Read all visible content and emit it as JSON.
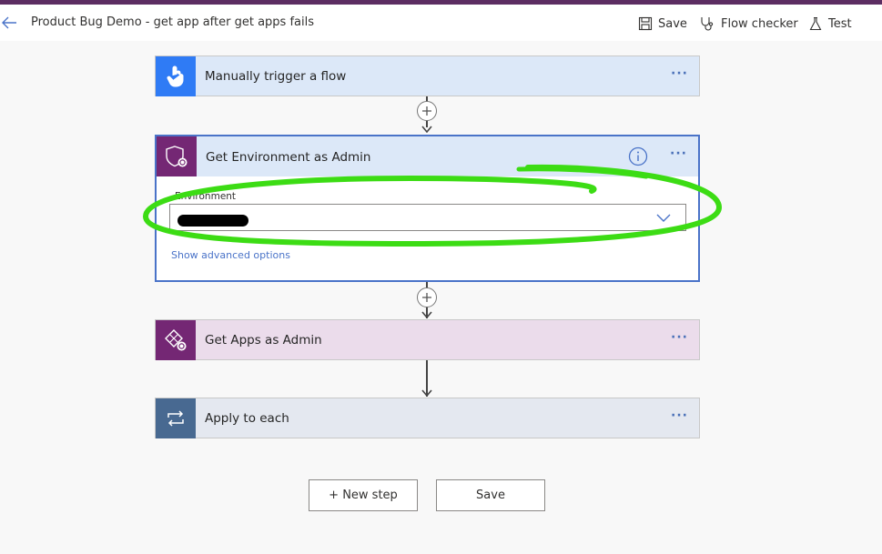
{
  "header": {
    "title": "Product Bug Demo - get app after get apps fails",
    "save_label": "Save",
    "flow_checker_label": "Flow checker",
    "test_label": "Test"
  },
  "steps": {
    "trigger": {
      "label": "Manually trigger a flow",
      "more": "···",
      "icon": "hand-tap-icon",
      "color": "#2f7bf5"
    },
    "get_environment": {
      "label": "Get Environment as Admin",
      "more": "···",
      "icon": "shield-gear-icon",
      "color": "#742774",
      "field_label": "Environment",
      "advanced_label": "Show advanced options"
    },
    "get_apps": {
      "label": "Get Apps as Admin",
      "more": "···",
      "icon": "powerapps-gear-icon",
      "color": "#742774"
    },
    "apply_each": {
      "label": "Apply to each",
      "more": "···",
      "icon": "loop-icon",
      "color": "#486991"
    }
  },
  "footer": {
    "new_step_label": "+ New step",
    "save_label": "Save"
  },
  "colors": {
    "accent": "#5c2d62",
    "highlight_scribble": "#3cdc14",
    "link": "#4a73c8"
  }
}
